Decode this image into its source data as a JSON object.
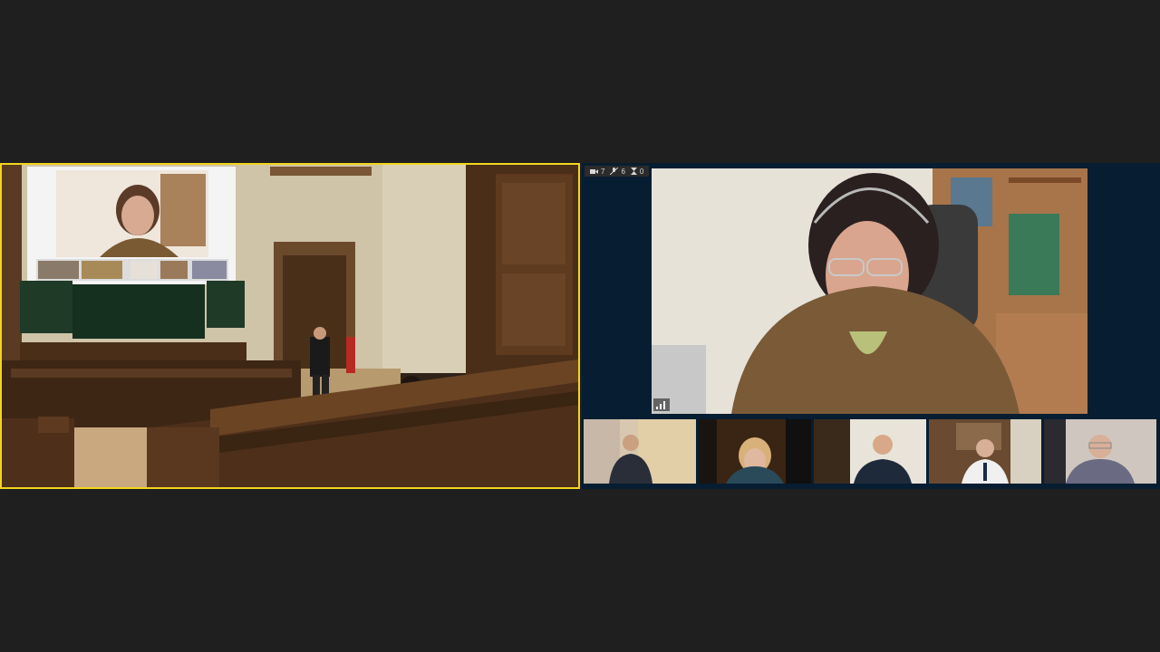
{
  "meeting": {
    "stats": {
      "video_count": "7",
      "muted_count": "6",
      "waiting_count": "0"
    }
  },
  "colors": {
    "background": "#1f1f1f",
    "active_speaker_border": "#f2d51d",
    "panel_background": "#071d32"
  },
  "icons": [
    "camera-icon",
    "mic-off-icon",
    "hourglass-icon",
    "signal-icon"
  ]
}
